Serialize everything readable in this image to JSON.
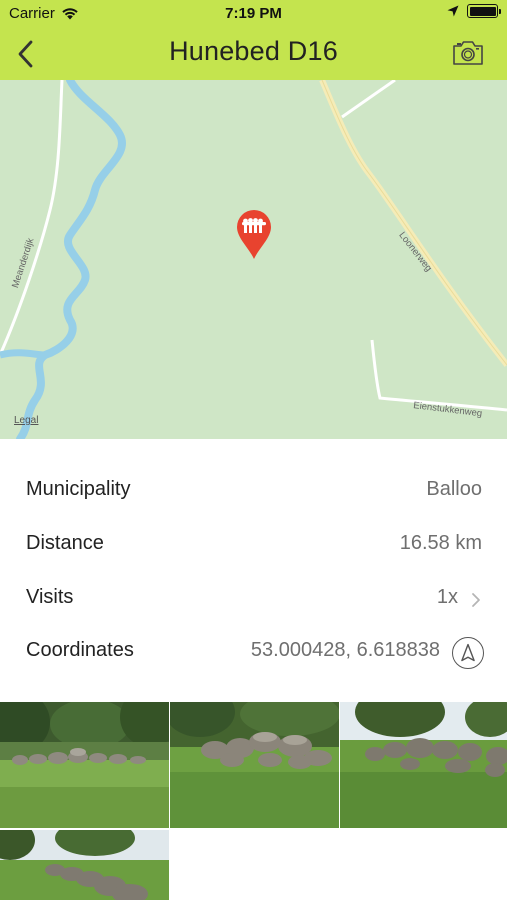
{
  "status": {
    "carrier": "Carrier",
    "time": "7:19 PM"
  },
  "header": {
    "title": "Hunebed D16",
    "back_icon": "chevron-left-icon",
    "camera_icon": "camera-icon",
    "color": "#c4e44e"
  },
  "map": {
    "legal": "Legal",
    "roads": [
      "Meanderdijk",
      "Loonerweg",
      "Eienstukkenweg"
    ],
    "pin_color": "#e8432f"
  },
  "details": {
    "rows": [
      {
        "label": "Municipality",
        "value": "Balloo"
      },
      {
        "label": "Distance",
        "value": "16.58 km"
      },
      {
        "label": "Visits",
        "value": "1x"
      },
      {
        "label": "Coordinates",
        "value": "53.000428, 6.618838"
      }
    ],
    "navigate_icon": "navigation-icon"
  },
  "photos": {
    "count": 4,
    "alt": [
      "Hunebed photo 1",
      "Hunebed photo 2",
      "Hunebed photo 3",
      "Hunebed photo 4"
    ]
  }
}
